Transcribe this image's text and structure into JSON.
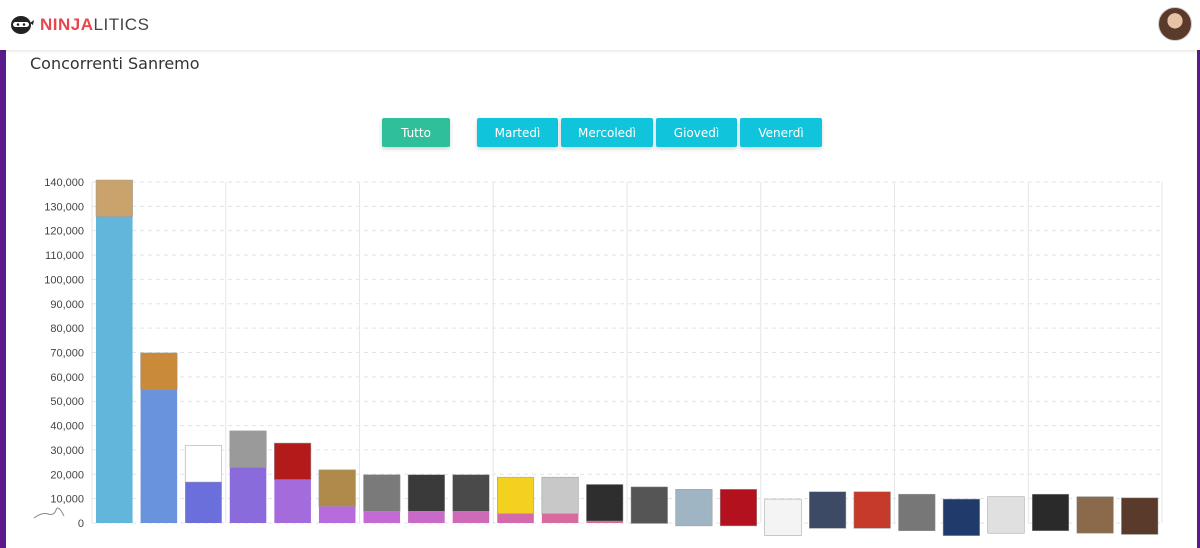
{
  "app": {
    "logo_brand_a": "NINJA",
    "logo_brand_b": "LITICS"
  },
  "page": {
    "title": "Concorrenti Sanremo"
  },
  "filters": {
    "all_label": "Tutto",
    "days": [
      "Martedì",
      "Mercoledì",
      "Giovedì",
      "Venerdì"
    ],
    "selected": "Tutto"
  },
  "colors": {
    "brand_red": "#e8464e",
    "frame_purple": "#5b1a8c",
    "filter_all": "#2fbf9a",
    "filter_day": "#10c4dc"
  },
  "chart_data": {
    "type": "bar",
    "ylim": [
      0,
      140000
    ],
    "y_ticks": [
      0,
      10000,
      20000,
      30000,
      40000,
      50000,
      60000,
      70000,
      80000,
      90000,
      100000,
      110000,
      120000,
      130000,
      140000
    ],
    "y_tick_labels": [
      "0",
      "10,000",
      "20,000",
      "30,000",
      "40,000",
      "50,000",
      "60,000",
      "70,000",
      "80,000",
      "90,000",
      "100,000",
      "110,000",
      "120,000",
      "130,000",
      "140,000"
    ],
    "grid": true,
    "values": [
      140000,
      69000,
      31000,
      37000,
      32000,
      21000,
      19000,
      19000,
      19000,
      18000,
      18000,
      15000,
      14000,
      13000,
      13000,
      9000,
      12000,
      12000,
      11000,
      9000,
      10000,
      11000,
      10000,
      9500
    ],
    "bar_colors": [
      "#62b6dc",
      "#6993dd",
      "#6b6fdc",
      "#8a6bdc",
      "#a46bdc",
      "#b76bdc",
      "#c46ad5",
      "#c96ac8",
      "#cf6ab9",
      "#d46aac",
      "#d86aa0",
      "#da6a95",
      "#dc6a8b",
      "#dd6b82",
      "#de6b7a",
      "#df6b73",
      "#df6c6c",
      "#df6c66",
      "#df6c60",
      "#df6d5b",
      "#df6e57",
      "#df6f53",
      "#df7050",
      "#df714d"
    ],
    "thumb_colors": [
      "#c9a36b",
      "#c98a3a",
      "#ffffff",
      "#9a9a9a",
      "#b31b1b",
      "#b08a4a",
      "#7a7a7a",
      "#3a3a3a",
      "#4a4a4a",
      "#f2d21e",
      "#c8c8c8",
      "#2e2e2e",
      "#555555",
      "#9fb5c4",
      "#b3111e",
      "#f4f4f4",
      "#3d4a66",
      "#c63a2b",
      "#777777",
      "#1f3a6b",
      "#e0e0e0",
      "#2a2a2a",
      "#8a6a4a",
      "#5a3a2a"
    ]
  }
}
